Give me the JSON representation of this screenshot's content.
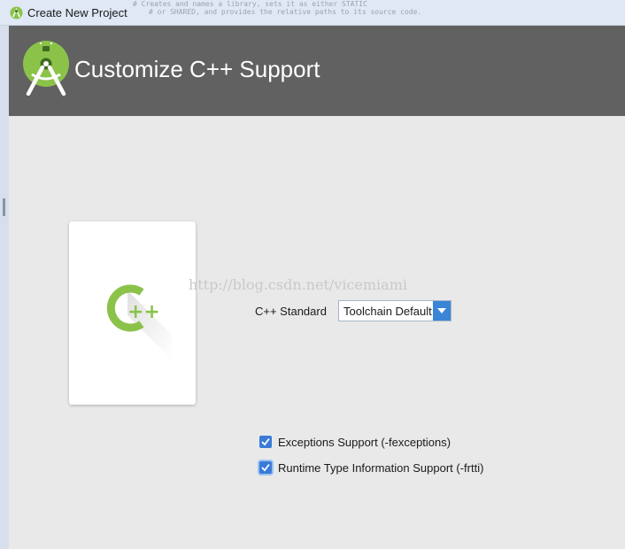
{
  "window": {
    "title": "Create New Project",
    "background_text": [
      "# Creates and names a library, sets it as either STATIC",
      "# or SHARED, and provides the relative paths to its source code."
    ]
  },
  "header": {
    "title": "Customize C++ Support",
    "icon": "android-studio-logo-icon"
  },
  "card": {
    "icon": "cpp-icon",
    "symbol": "++"
  },
  "watermark": "http://blog.csdn.net/vicemiami",
  "form": {
    "cpp_standard": {
      "label": "C++ Standard",
      "selected": "Toolchain Default"
    },
    "options": [
      {
        "label": "Exceptions Support (-fexceptions)",
        "checked": true
      },
      {
        "label": "Runtime Type Information Support (-frtti)",
        "checked": true
      }
    ]
  },
  "colors": {
    "header_bg": "#616161",
    "android_green": "#8bc34a",
    "accent_blue": "#3a85d6",
    "content_bg": "#e9e9e9"
  }
}
